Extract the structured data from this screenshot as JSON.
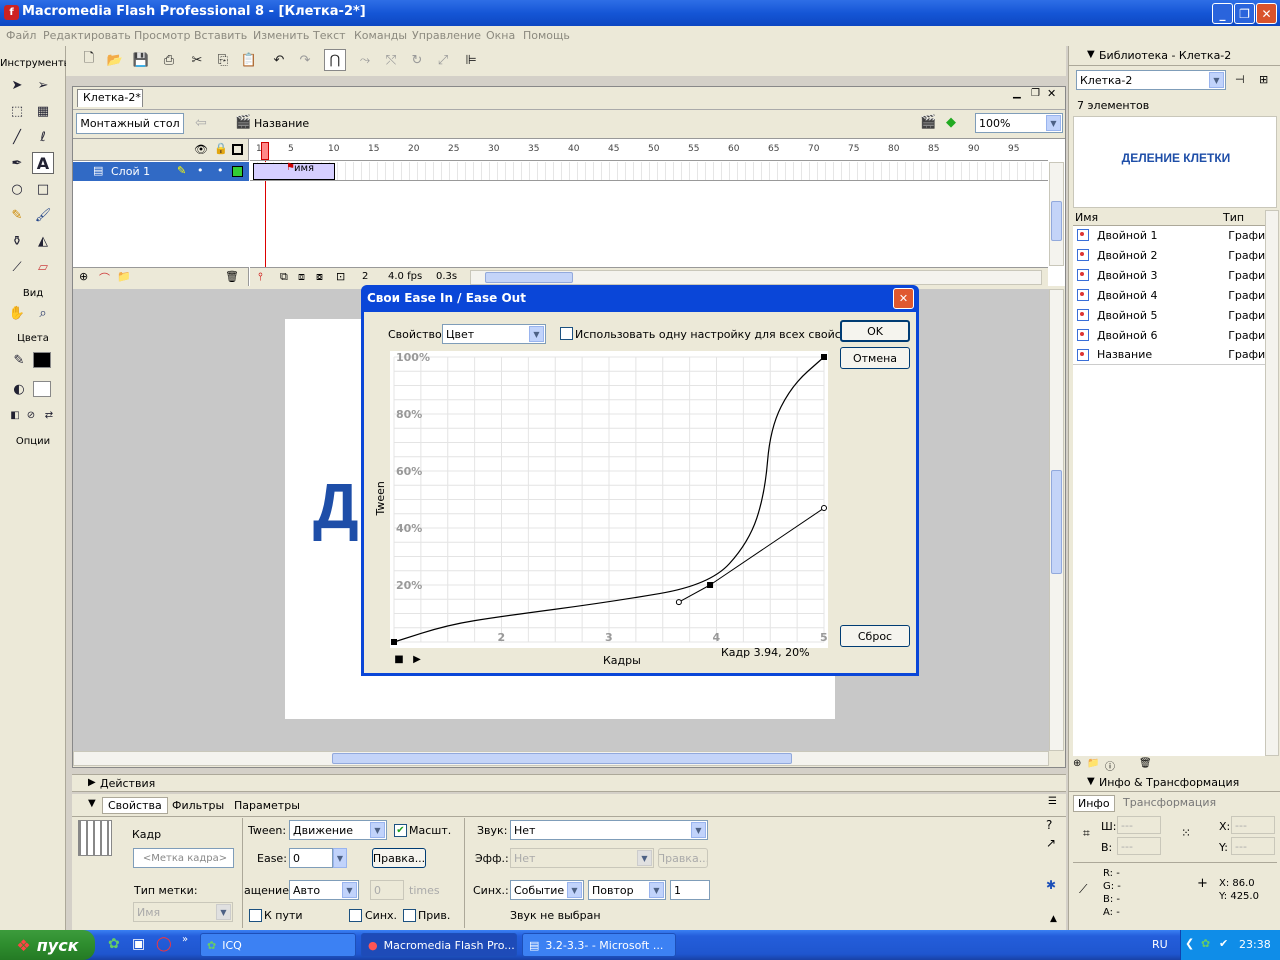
{
  "window": {
    "title": "Macromedia Flash Professional 8 - [Клетка-2*]"
  },
  "menu": [
    "Файл",
    "Редактировать",
    "Просмотр",
    "Вставить",
    "Изменить",
    "Текст",
    "Команды",
    "Управление",
    "Окна",
    "Помощь"
  ],
  "tools": {
    "header": "Инструменты",
    "view_label": "Вид",
    "colors_label": "Цвета",
    "options_label": "Опции"
  },
  "document": {
    "tab": "Клетка-2*",
    "scene_button": "Монтажный стол",
    "scene_name": "Название",
    "zoom": "100%"
  },
  "timeline": {
    "layer_name": "Слой 1",
    "frame_numbers": [
      "1",
      "5",
      "10",
      "15",
      "20",
      "25",
      "30",
      "35",
      "40",
      "45",
      "50",
      "55",
      "60",
      "65",
      "70",
      "75",
      "80",
      "85",
      "90",
      "95"
    ],
    "frame_label": "имя",
    "current_frame": "2",
    "fps": "4.0 fps",
    "elapsed": "0.3s"
  },
  "stage": {
    "visible_text": "Д"
  },
  "library": {
    "title": "Библиотека - Клетка-2",
    "dropdown": "Клетка-2",
    "count": "7 элементов",
    "preview_text": "ДЕЛЕНИЕ КЛЕТКИ",
    "col_name": "Имя",
    "col_type": "Тип",
    "items": [
      {
        "name": "Двойной 1",
        "type": "Графи"
      },
      {
        "name": "Двойной 2",
        "type": "Графи"
      },
      {
        "name": "Двойной 3",
        "type": "Графи"
      },
      {
        "name": "Двойной 4",
        "type": "Графи"
      },
      {
        "name": "Двойной 5",
        "type": "Графи"
      },
      {
        "name": "Двойной 6",
        "type": "Графи"
      },
      {
        "name": "Название",
        "type": "Графи"
      }
    ]
  },
  "info_panel": {
    "title": "Инфо & Трансформация",
    "tab_info": "Инфо",
    "tab_transform": "Трансформация",
    "w_label": "Ш:",
    "h_label": "В:",
    "x_label": "X:",
    "y_label": "Y:",
    "dash": "---",
    "r": "R: -",
    "g": "G: -",
    "b": "B: -",
    "a": "A: -",
    "cursor_x": "X:  86.0",
    "cursor_y": "Y:  425.0"
  },
  "actions_panel": {
    "title": "Действия"
  },
  "properties": {
    "tabs": [
      "Свойства",
      "Фильтры",
      "Параметры"
    ],
    "frame_label": "Кадр",
    "frame_placeholder": "<Метка кадра>",
    "label_type": "Тип метки:",
    "label_type_value": "Имя",
    "tween_label": "Tween:",
    "tween_value": "Движение",
    "scale_label": "Масшт.",
    "ease_label": "Ease:",
    "ease_value": "0",
    "edit_button": "Правка...",
    "rotate_label": "ащение:",
    "rotate_value": "Авто",
    "times_value": "0",
    "times_label": "times",
    "to_path": "К пути",
    "sync": "Синх.",
    "snap": "Прив.",
    "sound_label": "Звук:",
    "sound_value": "Нет",
    "effect_label": "Эфф.:",
    "effect_value": "Нет",
    "effect_edit": "Правка...",
    "sync_label": "Синх.:",
    "sync_value": "Событие",
    "repeat_value": "Повтор",
    "repeat_count": "1",
    "no_sound": "Звук не выбран"
  },
  "dialog": {
    "title": "Свои Ease In / Ease Out",
    "property_label": "Свойство:",
    "property_value": "Цвет",
    "use_one_setting": "Использовать одну настройку для всех свойств",
    "ok": "OK",
    "cancel": "Отмена",
    "reset": "Сброс",
    "frames_label": "Кадры",
    "status": "Кадр 3.94,     20%"
  },
  "chart_data": {
    "type": "line",
    "title": "",
    "xlabel": "Кадры",
    "ylabel": "Tween",
    "x_ticks": [
      "2",
      "3",
      "4",
      "5"
    ],
    "y_ticks": [
      "20%",
      "40%",
      "60%",
      "80%",
      "100%"
    ],
    "xlim": [
      1,
      5
    ],
    "ylim": [
      0,
      100
    ],
    "grid": true,
    "series": [
      {
        "points": [
          [
            1,
            0
          ],
          [
            1.5,
            6
          ],
          [
            2,
            9
          ],
          [
            3,
            14
          ],
          [
            3.94,
            20
          ],
          [
            4.3,
            35
          ],
          [
            4.45,
            52
          ],
          [
            4.5,
            75
          ],
          [
            4.7,
            90
          ],
          [
            5,
            100
          ]
        ]
      }
    ],
    "control_points": [
      [
        1,
        0
      ],
      [
        3.94,
        20
      ],
      [
        5,
        100
      ]
    ],
    "tangent_handles": [
      [
        3.65,
        14
      ],
      [
        5,
        47
      ]
    ]
  },
  "taskbar": {
    "start": "пуск",
    "tasks": [
      "ICQ",
      "Macromedia Flash Pro...",
      "3.2-3.3- - Microsoft ..."
    ],
    "lang": "RU",
    "clock": "23:38"
  }
}
